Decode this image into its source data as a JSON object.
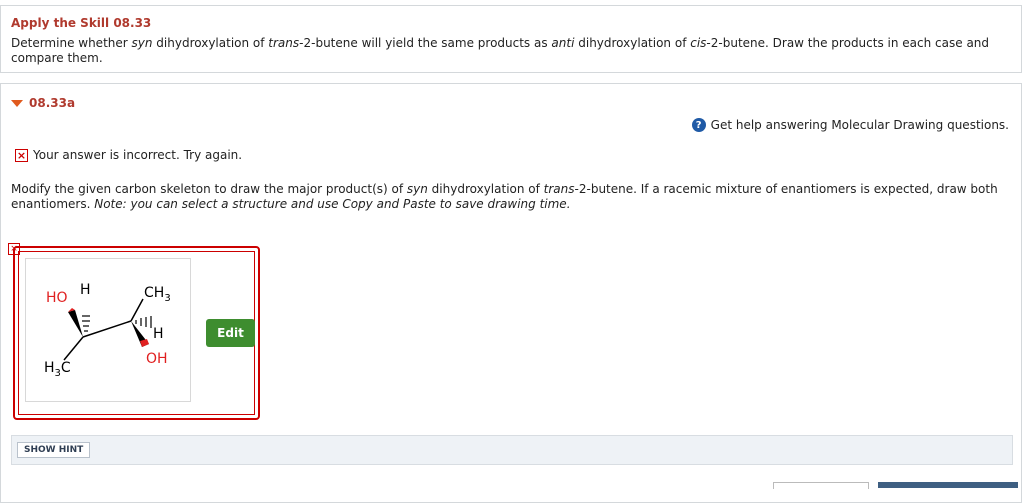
{
  "header": {
    "skill_title": "Apply the Skill 08.33",
    "question": "Determine whether syn dihydroxylation of trans-2-butene will yield the same products as anti dihydroxylation of cis-2-butene. Draw the products in each case and compare them."
  },
  "part": {
    "label": "08.33a",
    "help_text": "Get help answering Molecular Drawing questions.",
    "feedback": "Your answer is incorrect.  Try again.",
    "instructions_main": "Modify the given carbon skeleton to draw the major product(s) of syn dihydroxylation of trans-2-butene. If a racemic mixture of enantiomers is expected, draw both enantiomers.",
    "instructions_note": "Note: you can select a structure and use Copy and Paste to save drawing time."
  },
  "drawing": {
    "label_ho": "HO",
    "label_h_top": "H",
    "label_ch3": "CH",
    "label_ch3_sub": "3",
    "label_h_right": "H",
    "label_h3c": "H",
    "label_h3c_sub": "3",
    "label_h3c_c": "C",
    "label_oh": "OH"
  },
  "edit_button": "Edit",
  "hint_button": "SHOW HINT",
  "colors": {
    "accent": "#b03a2e",
    "error": "#cc0000",
    "edit": "#3e8d2f",
    "help": "#1f5aa6"
  }
}
